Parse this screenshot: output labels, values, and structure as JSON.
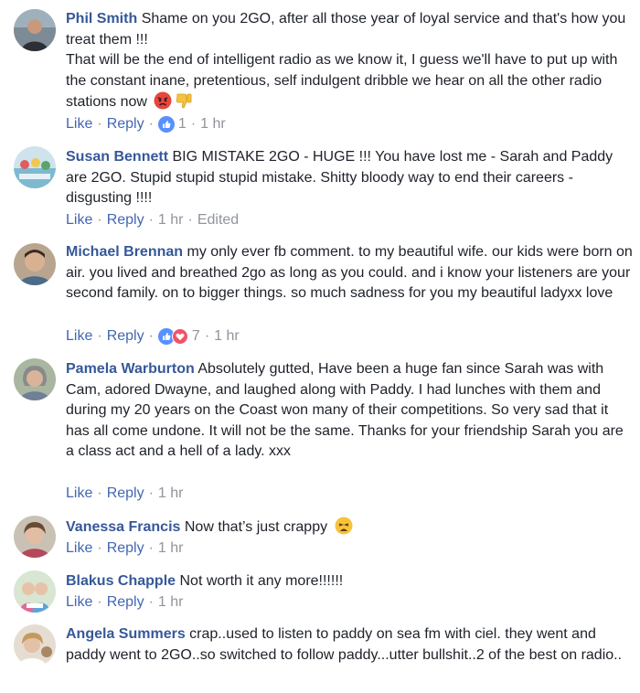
{
  "comments": [
    {
      "author": "Phil Smith",
      "text": "Shame on you 2GO, after all those year of loyal service and that's how you treat them !!! \nThat will be the end of intelligent radio as we know it, I guess we'll have to put up with the constant inane, pretentious, self indulgent dribble we hear on all the other radio stations now",
      "emojis": [
        "angry-face-icon",
        "thumbs-down-icon"
      ],
      "like": "Like",
      "reply": "Reply",
      "reactions": "1",
      "time": "1 hr"
    },
    {
      "author": "Susan Bennett",
      "text": "BIG MISTAKE 2GO - HUGE !!! You have lost me - Sarah and Paddy are 2GO. Stupid stupid stupid mistake. Shitty bloody way to end their careers - disgusting !!!!",
      "like": "Like",
      "reply": "Reply",
      "time": "1 hr",
      "edited": "Edited"
    },
    {
      "author": "Michael Brennan",
      "text": "my only ever fb comment. to my beautiful wife. our kids were born on air. you lived and breathed 2go as long as you could. and i know your listeners are your second family. on to bigger things. so much sadness for you my beautiful ladyxx love",
      "like": "Like",
      "reply": "Reply",
      "reactions": "7",
      "time": "1 hr"
    },
    {
      "author": "Pamela Warburton",
      "text": "Absolutely gutted, Have been a huge fan since Sarah was with Cam, adored Dwayne, and laughed along with Paddy. I had lunches with them and during my 20 years on the Coast won many of their competitions. So very sad that it has all come undone. It will not be the same. Thanks for your friendship Sarah you are a class act and a hell of a lady. xxx",
      "like": "Like",
      "reply": "Reply",
      "time": "1 hr"
    },
    {
      "author": "Vanessa Francis",
      "text": "Now that’s just crappy",
      "emojis": [
        "tired-face-icon"
      ],
      "like": "Like",
      "reply": "Reply",
      "time": "1 hr"
    },
    {
      "author": "Blakus Chapple",
      "text": "Not worth it any more!!!!!!",
      "like": "Like",
      "reply": "Reply",
      "time": "1 hr"
    },
    {
      "author": "Angela Summers",
      "text": "crap..used to listen to paddy on sea fm with ciel. they went and paddy went to 2GO..so switched to follow paddy...utter bullshit..2 of the best on radio..",
      "like": "Like",
      "reply": "Reply",
      "time": "1 hr"
    }
  ],
  "colors": {
    "author": "#365899",
    "link": "#4267b2",
    "muted": "#90949c",
    "text": "#1d2129",
    "like_reaction": "#5890ff",
    "love_reaction": "#f25268"
  }
}
